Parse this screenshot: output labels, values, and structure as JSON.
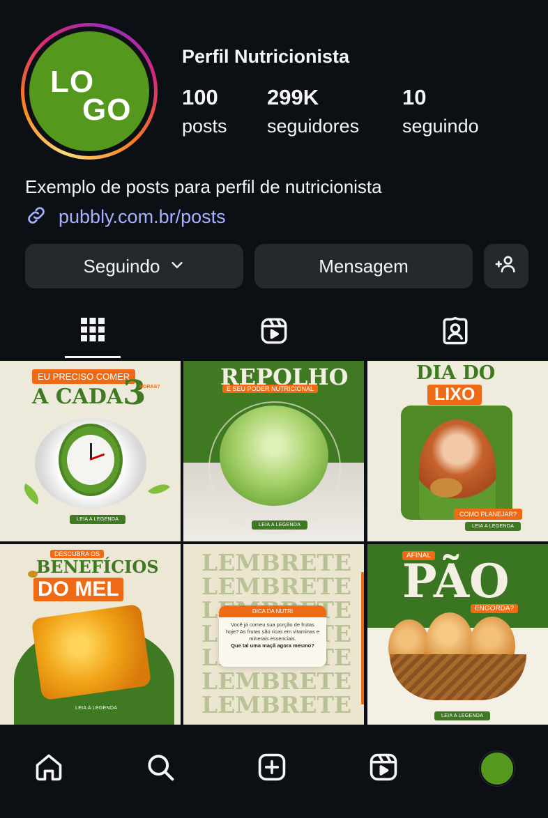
{
  "profile": {
    "name": "Perfil Nutricionista",
    "logo_line1": "LO",
    "logo_line2": "GO",
    "bio": "Exemplo de posts para perfil de nutricionista",
    "link": "pubbly.com.br/posts",
    "brand_color": "#54981d"
  },
  "stats": {
    "posts_count": "100",
    "posts_label": "posts",
    "followers_count": "299K",
    "followers_label": "seguidores",
    "following_count": "10",
    "following_label": "seguindo"
  },
  "actions": {
    "following_label": "Seguindo",
    "message_label": "Mensagem",
    "add_person_icon": "add-person-icon"
  },
  "tabs": [
    {
      "icon": "grid-icon",
      "active": true
    },
    {
      "icon": "reels-icon",
      "active": false
    },
    {
      "icon": "tagged-icon",
      "active": false
    }
  ],
  "posts": {
    "p1": {
      "top": "EU PRECISO COMER",
      "main": "A CADA",
      "num": "3",
      "small": "HORAS?",
      "cta": "LEIA A LEGENDA"
    },
    "p2": {
      "title": "REPOLHO",
      "subtitle": "E SEU PODER NUTRICIONAL",
      "cta": "LEIA A LEGENDA"
    },
    "p3": {
      "line1": "DIA DO",
      "line2": "LIXO",
      "question": "COMO PLANEJAR?",
      "cta": "LEIA A LEGENDA"
    },
    "p4": {
      "top": "DESCUBRA OS",
      "line1": "BENEFÍCIOS",
      "line2": "DO MEL",
      "cta": "LEIA A LEGENDA"
    },
    "p5": {
      "word": "LEMBRETE",
      "card_title": "DICA DA NUTRI",
      "card_text": "Você já comeu sua porção de frutas hoje? As frutas são ricas em vitaminas e minerais essenciais.",
      "card_bold": "Que tal uma maçã agora mesmo?"
    },
    "p6": {
      "top": "AFINAL",
      "title": "PÃO",
      "question": "ENGORDA?",
      "cta": "LEIA A LEGENDA"
    }
  },
  "bottom_nav": [
    "home-icon",
    "search-icon",
    "create-icon",
    "reels-icon",
    "profile-avatar"
  ]
}
